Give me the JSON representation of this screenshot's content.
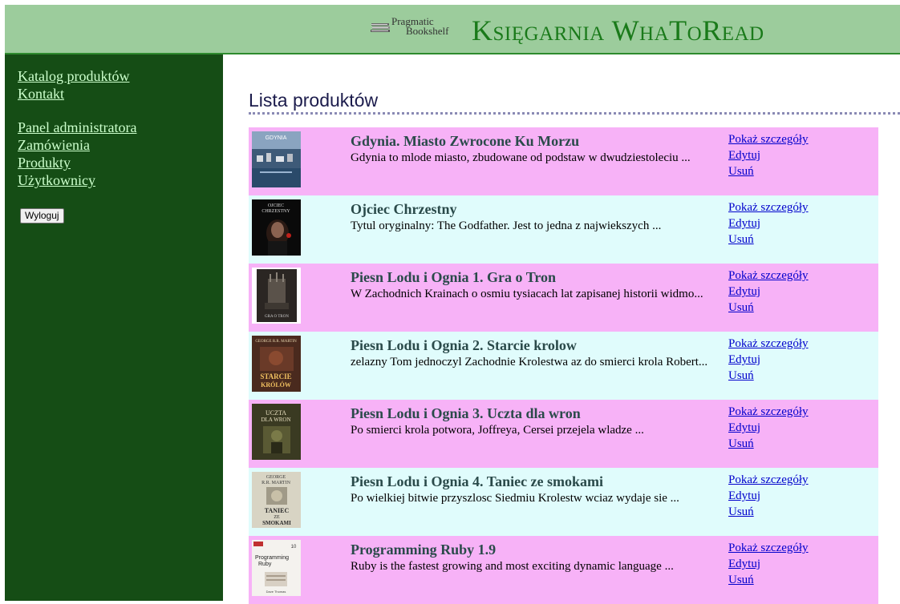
{
  "header": {
    "logo_line1": "Pragmatic",
    "logo_line2": "Bookshelf",
    "title": "Księgarnia WhaToRead"
  },
  "sidebar": {
    "links": [
      "Katalog produktów",
      "Kontakt"
    ],
    "admin_links": [
      "Panel administratora",
      "Zamówienia",
      "Produkty",
      "Użytkownicy"
    ],
    "logout_label": "Wyloguj"
  },
  "main": {
    "heading": "Lista produktów"
  },
  "actions": {
    "show": "Pokaż szczegóły",
    "edit": "Edytuj",
    "delete": "Usuń"
  },
  "cover_texts": {
    "gdynia": "GDYNIA",
    "ojciec_line1": "OJCIEC",
    "ojciec_line2": "CHRZESTNY",
    "tron": "GRA O TRON",
    "starcie_author": "GEORGE R.R. MARTIN",
    "starcie_line1": "STARCIE",
    "starcie_line2": "KRÓLÓW",
    "uczta_line1": "UCZTA",
    "uczta_line2": "DLA WRON",
    "taniec_author1": "GEORGE",
    "taniec_author2": "R.R. MARTIN",
    "taniec_line1": "TANIEC",
    "taniec_line2": "ZE",
    "taniec_line3": "SMOKAMI",
    "ruby_line1": "Programming",
    "ruby_line2": "Ruby",
    "ruby_num": "10",
    "ruby_author": "Dave Thomas"
  },
  "products": [
    {
      "title": "Gdynia. Miasto Zwrocone Ku Morzu",
      "description": "Gdynia to mlode miasto, zbudowane od podstaw w dwudziestoleciu ..."
    },
    {
      "title": "Ojciec Chrzestny",
      "description": "Tytul oryginalny: The Godfather. Jest to jedna z najwiekszych ..."
    },
    {
      "title": "Piesn Lodu i Ognia 1. Gra o Tron",
      "description": "W Zachodnich Krainach o osmiu tysiacach lat zapisanej historii widmo..."
    },
    {
      "title": "Piesn Lodu i Ognia 2. Starcie krolow",
      "description": "zelazny Tom jednoczyl Zachodnie Krolestwa az do smierci krola Robert..."
    },
    {
      "title": "Piesn Lodu i Ognia 3. Uczta dla wron",
      "description": "Po smierci krola potwora, Joffreya, Cersei przejela wladze ..."
    },
    {
      "title": "Piesn Lodu i Ognia 4. Taniec ze smokami",
      "description": "Po wielkiej bitwie przyszlosc Siedmiu Krolestw wciaz wydaje sie ..."
    },
    {
      "title": "Programming Ruby 1.9",
      "description": "Ruby is the fastest growing and most exciting dynamic language ..."
    }
  ]
}
